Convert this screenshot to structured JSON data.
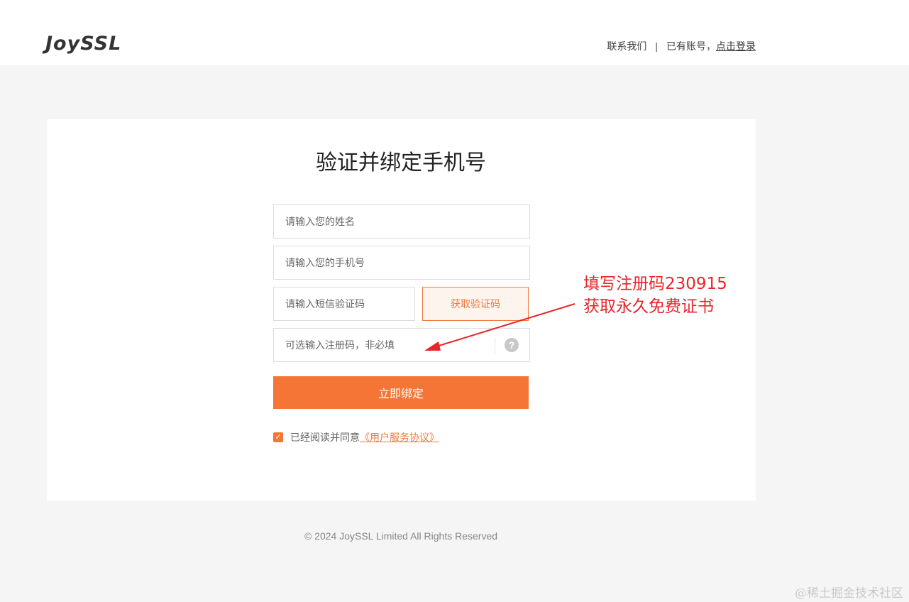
{
  "header": {
    "logo": "JoySSL",
    "contact_label": "联系我们",
    "separator": "|",
    "has_account_text": "已有账号，",
    "login_label": "点击登录"
  },
  "form": {
    "title": "验证并绑定手机号",
    "name_placeholder": "请输入您的姓名",
    "phone_placeholder": "请输入您的手机号",
    "sms_placeholder": "请输入短信验证码",
    "get_code_label": "获取验证码",
    "reg_code_placeholder": "可选输入注册码，非必填",
    "help_icon_glyph": "?",
    "submit_label": "立即绑定",
    "agree_checked": true,
    "agree_text": "已经阅读并同意",
    "agreement_link": "《用户服务协议》"
  },
  "footer": {
    "copyright": "© 2024 JoySSL Limited All Rights Reserved"
  },
  "annotation": {
    "line1": "填写注册码230915",
    "line2": "获取永久免费证书"
  },
  "watermark": "@稀土掘金技术社区",
  "colors": {
    "accent": "#f47536",
    "annotation": "#e8262a",
    "background": "#f5f5f5"
  }
}
